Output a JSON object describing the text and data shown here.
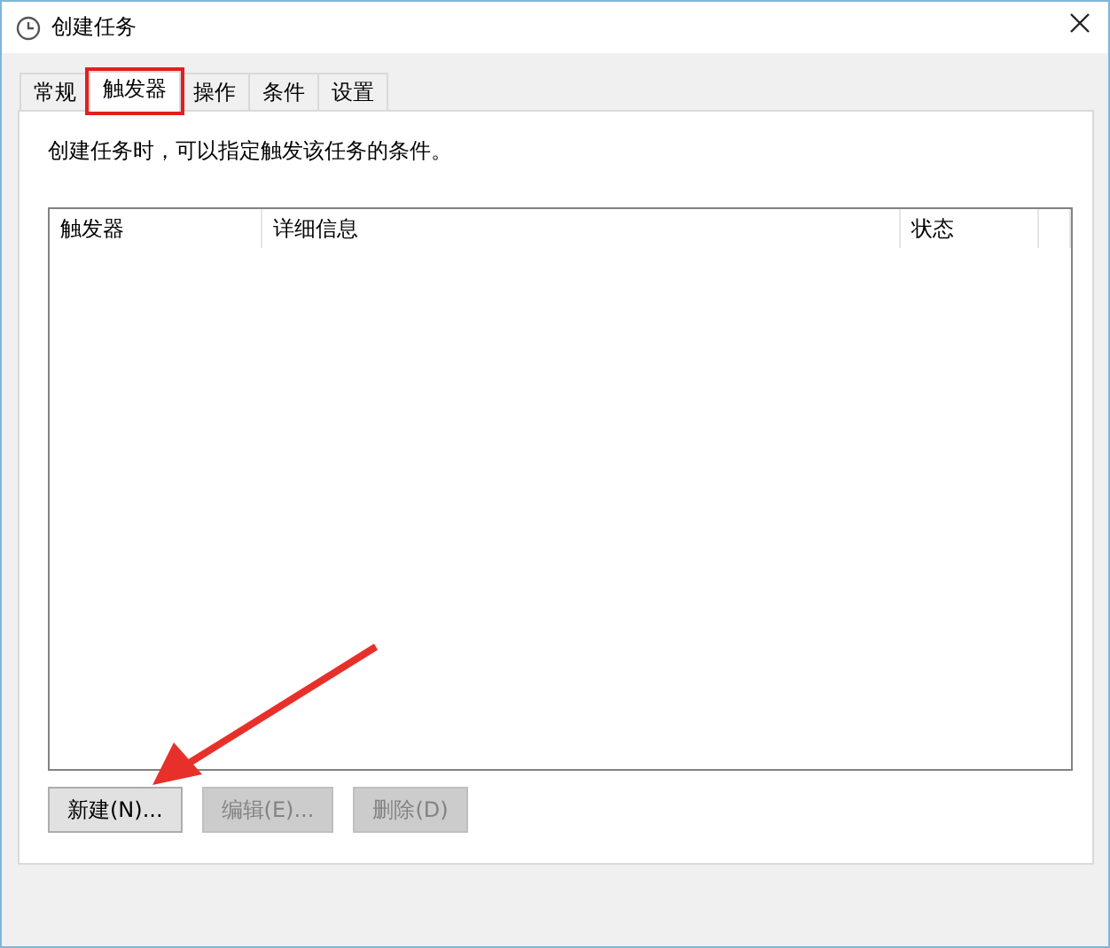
{
  "window": {
    "title": "创建任务"
  },
  "tabs": [
    {
      "label": "常规",
      "selected": false
    },
    {
      "label": "触发器",
      "selected": true
    },
    {
      "label": "操作",
      "selected": false
    },
    {
      "label": "条件",
      "selected": false
    },
    {
      "label": "设置",
      "selected": false
    }
  ],
  "description": "创建任务时，可以指定触发该任务的条件。",
  "table": {
    "columns": [
      "触发器",
      "详细信息",
      "状态"
    ]
  },
  "buttons": [
    {
      "label": "新建(N)...",
      "disabled": false
    },
    {
      "label": "编辑(E)...",
      "disabled": true
    },
    {
      "label": "删除(D)",
      "disabled": true
    }
  ],
  "callouts": {
    "tab_highlight": true,
    "arrow_to_first_button": true
  }
}
